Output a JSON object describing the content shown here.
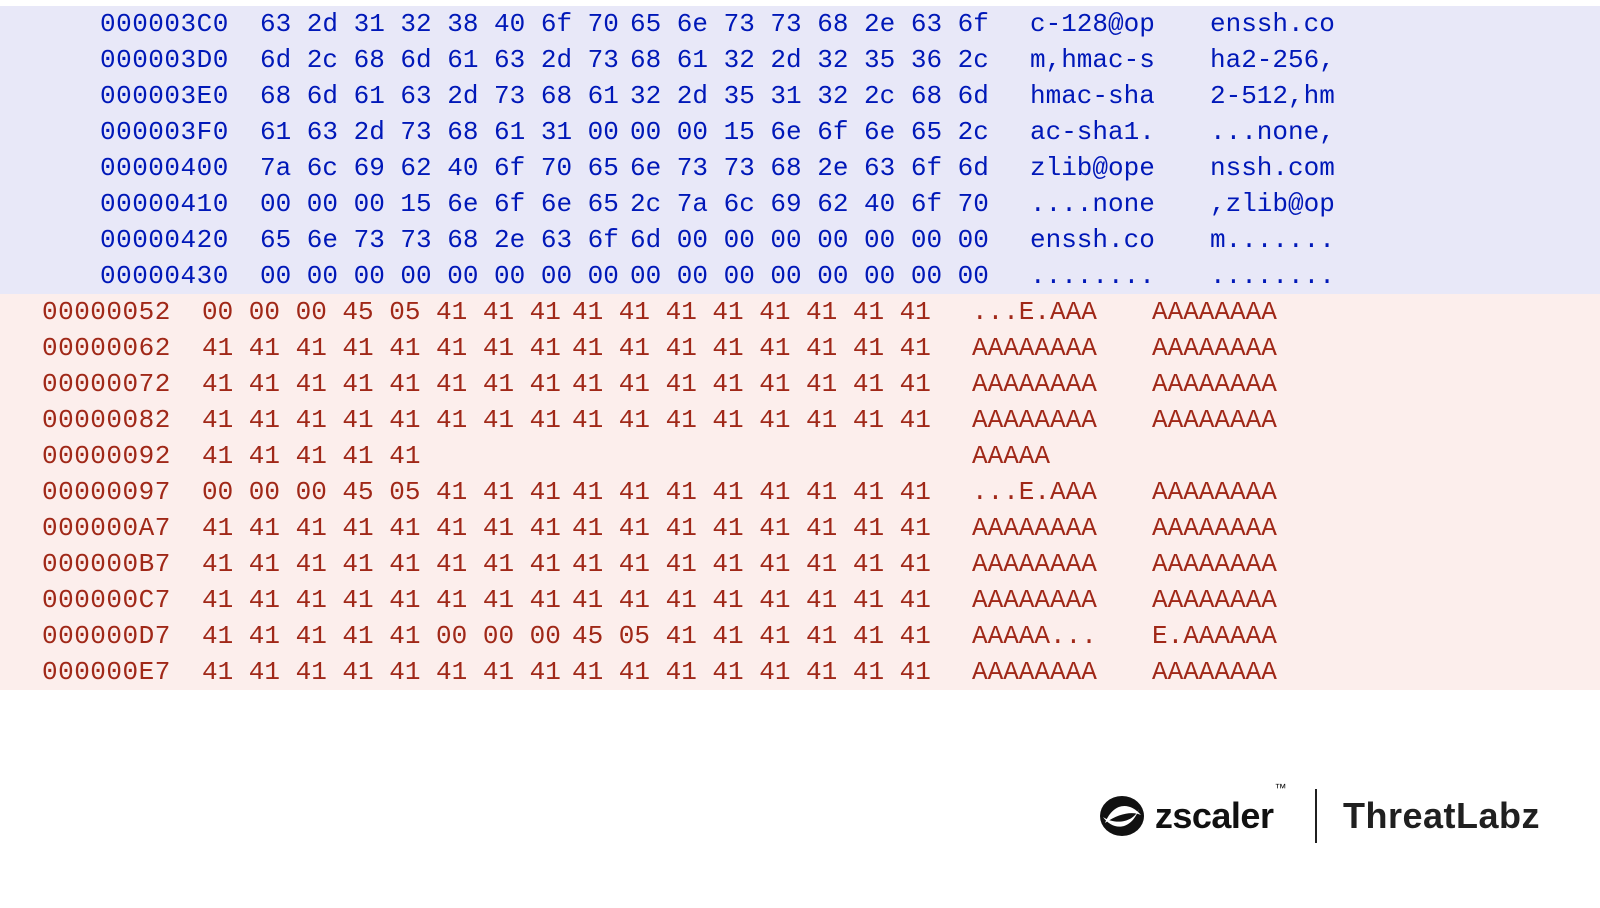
{
  "blue_rows": [
    {
      "offset": "000003C0",
      "h1": "63 2d 31 32 38 40 6f 70",
      "h2": "65 6e 73 73 68 2e 63 6f",
      "a1": "c-128@op",
      "a2": "enssh.co"
    },
    {
      "offset": "000003D0",
      "h1": "6d 2c 68 6d 61 63 2d 73",
      "h2": "68 61 32 2d 32 35 36 2c",
      "a1": "m,hmac-s",
      "a2": "ha2-256,"
    },
    {
      "offset": "000003E0",
      "h1": "68 6d 61 63 2d 73 68 61",
      "h2": "32 2d 35 31 32 2c 68 6d",
      "a1": "hmac-sha",
      "a2": "2-512,hm"
    },
    {
      "offset": "000003F0",
      "h1": "61 63 2d 73 68 61 31 00",
      "h2": "00 00 15 6e 6f 6e 65 2c",
      "a1": "ac-sha1.",
      "a2": "...none,"
    },
    {
      "offset": "00000400",
      "h1": "7a 6c 69 62 40 6f 70 65",
      "h2": "6e 73 73 68 2e 63 6f 6d",
      "a1": "zlib@ope",
      "a2": "nssh.com"
    },
    {
      "offset": "00000410",
      "h1": "00 00 00 15 6e 6f 6e 65",
      "h2": "2c 7a 6c 69 62 40 6f 70",
      "a1": "....none",
      "a2": ",zlib@op"
    },
    {
      "offset": "00000420",
      "h1": "65 6e 73 73 68 2e 63 6f",
      "h2": "6d 00 00 00 00 00 00 00",
      "a1": "enssh.co",
      "a2": "m......."
    },
    {
      "offset": "00000430",
      "h1": "00 00 00 00 00 00 00 00",
      "h2": "00 00 00 00 00 00 00 00",
      "a1": "........",
      "a2": "........"
    }
  ],
  "red_rows": [
    {
      "offset": "00000052",
      "h1": "00 00 00 45 05 41 41 41",
      "h2": "41 41 41 41 41 41 41 41",
      "a1": "...E.AAA",
      "a2": "AAAAAAAA"
    },
    {
      "offset": "00000062",
      "h1": "41 41 41 41 41 41 41 41",
      "h2": "41 41 41 41 41 41 41 41",
      "a1": "AAAAAAAA",
      "a2": "AAAAAAAA"
    },
    {
      "offset": "00000072",
      "h1": "41 41 41 41 41 41 41 41",
      "h2": "41 41 41 41 41 41 41 41",
      "a1": "AAAAAAAA",
      "a2": "AAAAAAAA"
    },
    {
      "offset": "00000082",
      "h1": "41 41 41 41 41 41 41 41",
      "h2": "41 41 41 41 41 41 41 41",
      "a1": "AAAAAAAA",
      "a2": "AAAAAAAA"
    },
    {
      "offset": "00000092",
      "h1": "41 41 41 41 41",
      "h2": "",
      "a1": "AAAAA",
      "a2": ""
    },
    {
      "offset": "00000097",
      "h1": "00 00 00 45 05 41 41 41",
      "h2": "41 41 41 41 41 41 41 41",
      "a1": "...E.AAA",
      "a2": "AAAAAAAA"
    },
    {
      "offset": "000000A7",
      "h1": "41 41 41 41 41 41 41 41",
      "h2": "41 41 41 41 41 41 41 41",
      "a1": "AAAAAAAA",
      "a2": "AAAAAAAA"
    },
    {
      "offset": "000000B7",
      "h1": "41 41 41 41 41 41 41 41",
      "h2": "41 41 41 41 41 41 41 41",
      "a1": "AAAAAAAA",
      "a2": "AAAAAAAA"
    },
    {
      "offset": "000000C7",
      "h1": "41 41 41 41 41 41 41 41",
      "h2": "41 41 41 41 41 41 41 41",
      "a1": "AAAAAAAA",
      "a2": "AAAAAAAA"
    },
    {
      "offset": "000000D7",
      "h1": "41 41 41 41 41 00 00 00",
      "h2": "45 05 41 41 41 41 41 41",
      "a1": "AAAAA...",
      "a2": "E.AAAAAA"
    },
    {
      "offset": "000000E7",
      "h1": "41 41 41 41 41 41 41 41",
      "h2": "41 41 41 41 41 41 41 41",
      "a1": "AAAAAAAA",
      "a2": "AAAAAAAA"
    }
  ],
  "footer": {
    "zscaler": "zscaler",
    "tm": "™",
    "threatlabz": "ThreatLabz"
  }
}
